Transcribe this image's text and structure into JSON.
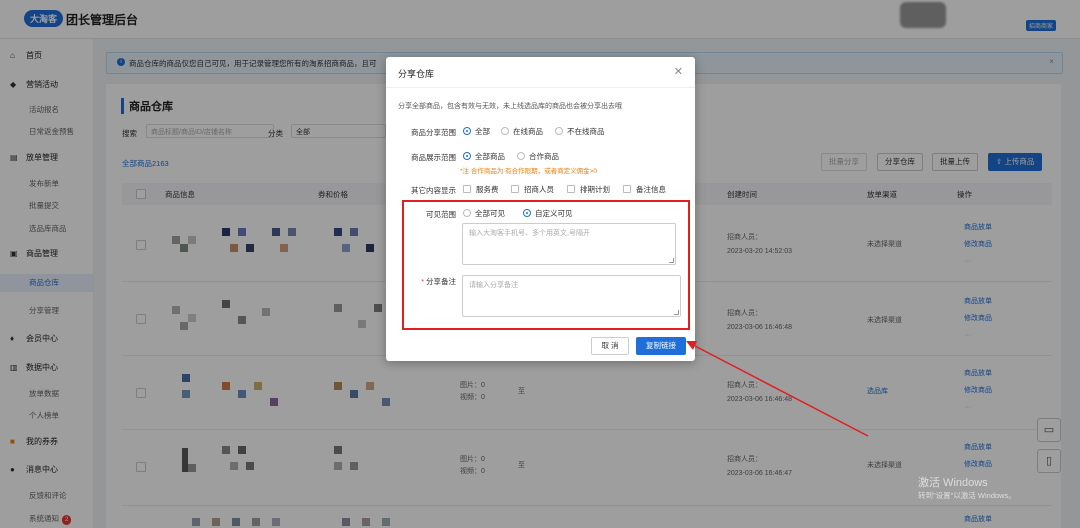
{
  "header": {
    "logo_text": "大淘客",
    "app_title": "团长管理后台",
    "role_badge": "招商商家"
  },
  "sidebar": {
    "home": "首页",
    "marketing": "营销活动",
    "marketing_items": [
      "活动报名",
      "日常返金预售"
    ],
    "order": "放单管理",
    "order_items": [
      "发布新单",
      "批量提交",
      "选品库商品"
    ],
    "goods": "商品管理",
    "goods_items": [
      "商品仓库",
      "分享管理"
    ],
    "member": "会员中心",
    "data": "数据中心",
    "data_items": [
      "放单数据",
      "个人榜单"
    ],
    "coupon": "我的券券",
    "message": "消息中心",
    "message_items": [
      "反馈和评论",
      "系统通知"
    ],
    "notice_count": "2"
  },
  "info_bar": {
    "text": "商品仓库的商品仅您自己可见，用于记录管理您所有的淘系招商商品，且可"
  },
  "page": {
    "title": "商品仓库",
    "search_label": "搜索",
    "search_placeholder": "商品标题/商品ID/店铺名称",
    "category_label": "分类",
    "category_value": "全部",
    "all_goods_tab": "全部商品2163",
    "batch_share": "批量分享",
    "share_warehouse": "分享仓库",
    "batch_upload": "批量上传",
    "upload_goods": "上传商品"
  },
  "table": {
    "headers": {
      "info": "商品信息",
      "coupon_price": "券和价格",
      "created": "创建时间",
      "channel": "放单渠道",
      "ops": "操作"
    },
    "rows": [
      {
        "creator_label": "招商人员：",
        "time": "2023-03-20 14:52:03",
        "channel": "未选择渠道",
        "op1": "商品放单",
        "op2": "修改商品",
        "op3": "···"
      },
      {
        "creator_label": "招商人员：",
        "time": "2023-03-06 16:46:48",
        "channel": "未选择渠道",
        "op1": "商品放单",
        "op2": "修改商品",
        "op3": "···"
      },
      {
        "image_label": "图片：0",
        "video_label": "视频：0",
        "extra": "至",
        "creator_label": "招商人员：",
        "time": "2023-03-06 16:46:48",
        "channel": "选品库",
        "op1": "商品放单",
        "op2": "修改商品",
        "op3": "···"
      },
      {
        "image_label": "图片：0",
        "video_label": "视频：0",
        "extra": "至",
        "creator_label": "招商人员：",
        "time": "2023-03-06 16:46:47",
        "channel": "未选择渠道",
        "op1": "商品放单",
        "op2": "修改商品",
        "op3": "···"
      },
      {
        "op1": "商品放单"
      }
    ]
  },
  "watermark": {
    "line1": "激活 Windows",
    "line2": "转到\"设置\"以激活 Windows。"
  },
  "dialog": {
    "title": "分享仓库",
    "close_icon": "close-icon",
    "description": "分享全部商品，包含有效与无效，未上线选品库的商品也会被分享出去哦",
    "scope": {
      "label": "商品分享范围",
      "options": [
        "全部",
        "在线商品",
        "不在线商品"
      ],
      "selected": 0
    },
    "display": {
      "label": "商品展示范围",
      "options": [
        "全部商品",
        "合作商品"
      ],
      "selected": 0
    },
    "display_note": "*注 合作商品为 有合作限期，或者商定义佣金>0",
    "other": {
      "label": "其它内容显示",
      "options": [
        "服务费",
        "招商人员",
        "排期计划",
        "备注信息"
      ]
    },
    "visibility": {
      "label": "可见范围",
      "options": [
        "全部可见",
        "自定义可见"
      ],
      "selected": 1
    },
    "phone_placeholder": "输入大淘客手机号、多个用英文,号隔开",
    "remark_label": "分享备注",
    "remark_placeholder": "请输入分享备注",
    "cancel": "取 消",
    "copy_link": "复制链接"
  }
}
